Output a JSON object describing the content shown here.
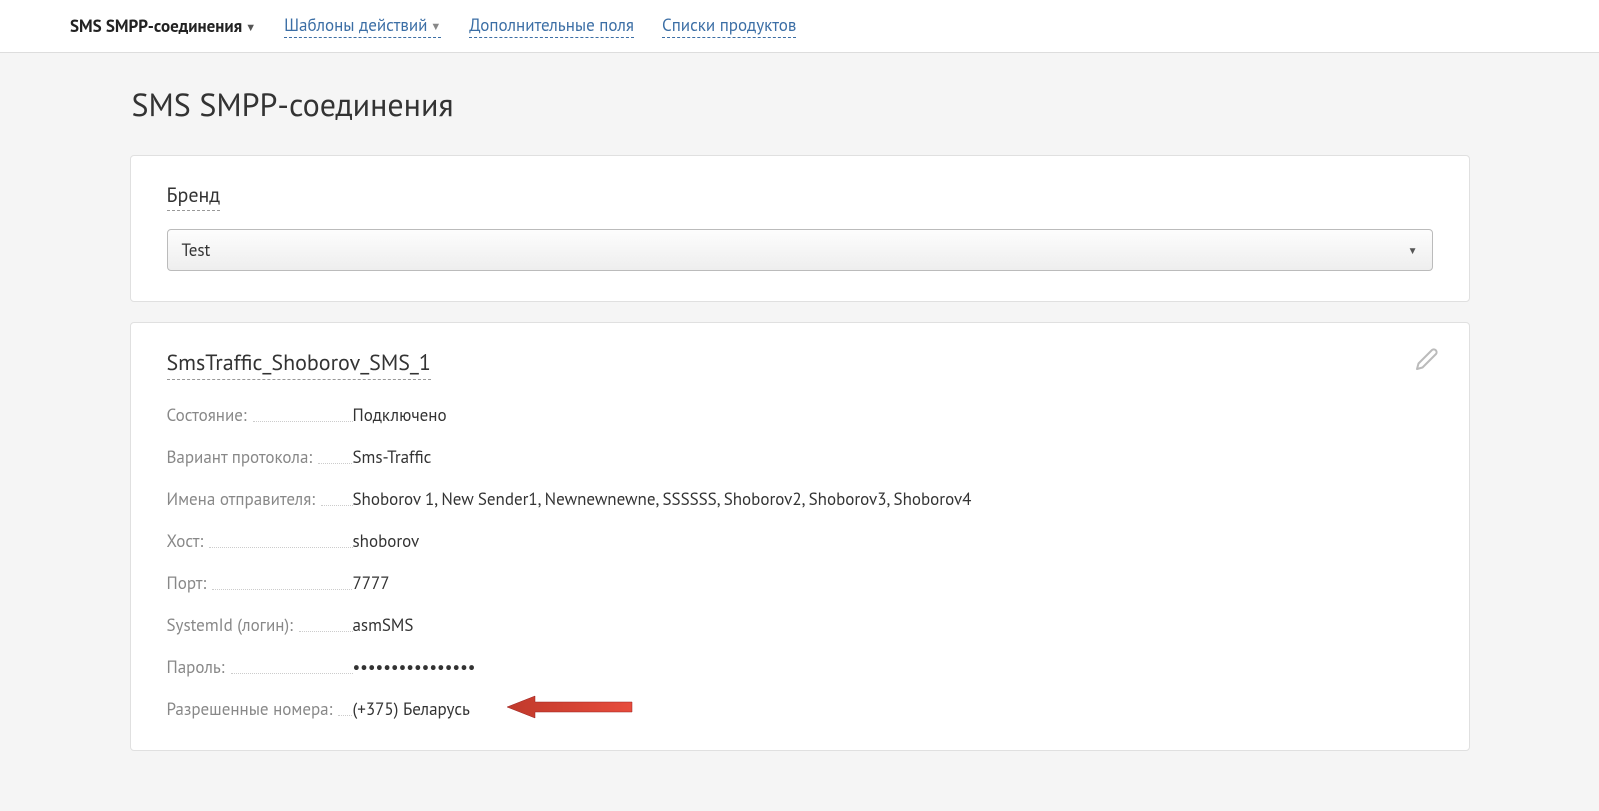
{
  "nav": {
    "items": [
      {
        "label": "SMS SMPP-соединения",
        "active": true,
        "dropdown": true,
        "underlined": false
      },
      {
        "label": "Шаблоны действий",
        "active": false,
        "dropdown": true,
        "underlined": true
      },
      {
        "label": "Дополнительные поля",
        "active": false,
        "dropdown": false,
        "underlined": true
      },
      {
        "label": "Списки продуктов",
        "active": false,
        "dropdown": false,
        "underlined": true
      }
    ]
  },
  "page": {
    "title": "SMS SMPP-соединения"
  },
  "brand_card": {
    "label": "Бренд",
    "selected": "Test"
  },
  "connection": {
    "title": "SmsTraffic_Shoborov_SMS_1",
    "rows": [
      {
        "label": "Состояние:",
        "value": "Подключено"
      },
      {
        "label": "Вариант протокола:",
        "value": "Sms-Traffic"
      },
      {
        "label": "Имена отправителя:",
        "value": "Shoborov 1, New Sender1, Newnewnewne, SSSSSS, Shoborov2, Shoborov3, Shoborov4"
      },
      {
        "label": "Хост:",
        "value": "shoborov"
      },
      {
        "label": "Порт:",
        "value": "7777"
      },
      {
        "label": "SystemId (логин):",
        "value": "asmSMS"
      },
      {
        "label": "Пароль:",
        "value": "••••••••••••••••"
      },
      {
        "label": "Разрешенные номера:",
        "value": "(+375) Беларусь"
      }
    ]
  }
}
